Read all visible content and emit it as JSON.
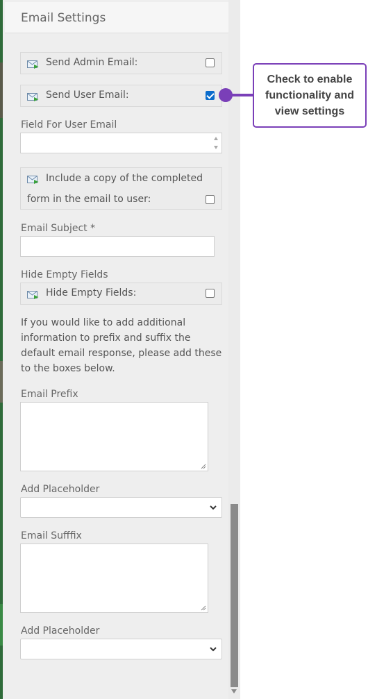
{
  "panel": {
    "title": "Email Settings",
    "send_admin_email": {
      "label": "Send Admin Email:",
      "checked": false
    },
    "send_user_email": {
      "label": "Send User Email:",
      "checked": true
    },
    "field_for_user_email": {
      "label": "Field For User Email",
      "value": ""
    },
    "include_copy": {
      "line1": "Include a copy of the completed",
      "line2": "form in the email to user:",
      "checked": false
    },
    "email_subject": {
      "label": "Email Subject *",
      "value": ""
    },
    "hide_empty_fields": {
      "section_label": "Hide Empty Fields",
      "label": "Hide Empty Fields:",
      "checked": false
    },
    "info_text": "If you would like to add additional information to prefix and suffix the default email response, please add these to the boxes below.",
    "email_prefix": {
      "label": "Email Prefix",
      "value": ""
    },
    "add_placeholder_1": {
      "label": "Add Placeholder",
      "selected": ""
    },
    "email_suffix": {
      "label": "Email Sufffix",
      "value": ""
    },
    "add_placeholder_2": {
      "label": "Add Placeholder",
      "selected": ""
    }
  },
  "callout": {
    "text": "Check to enable functionality and view settings",
    "color": "#7a3fb8"
  },
  "icons": {
    "row_icon": "mail-arrow-icon",
    "select_icon": "chevron-down-icon"
  },
  "colors": {
    "checkbox_checked": "#0b6ccc",
    "panel_bg": "#eeeeee"
  }
}
